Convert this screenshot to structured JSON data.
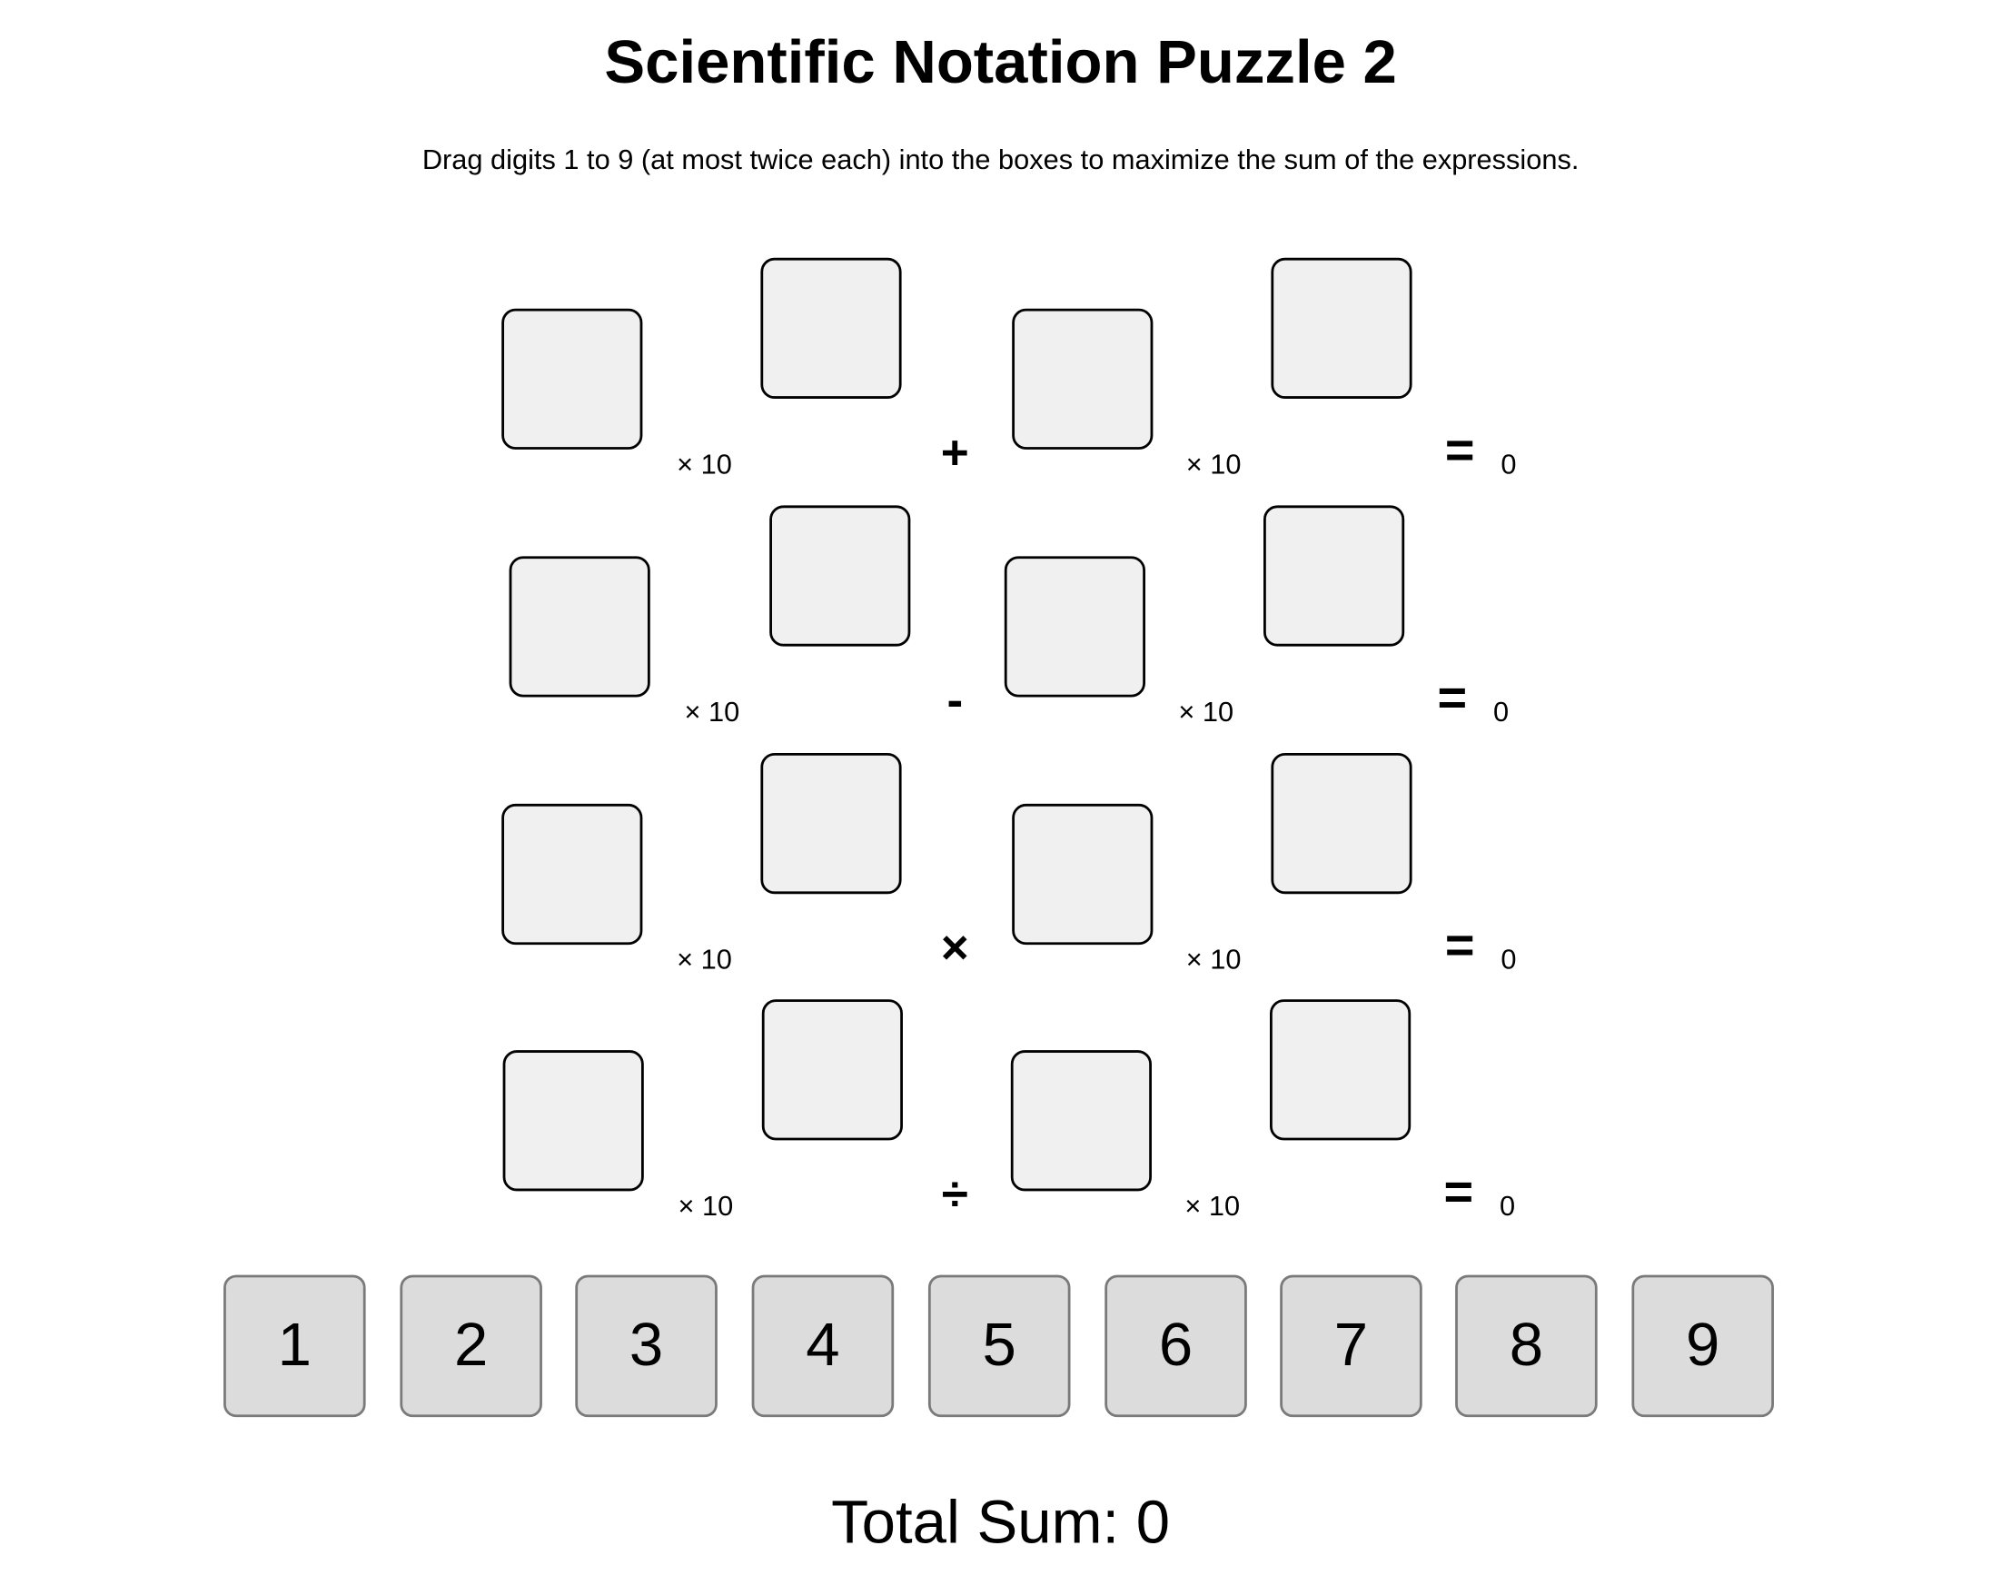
{
  "title": "Scientific Notation Puzzle 2",
  "instructions": "Drag digits 1 to 9 (at most twice each) into the boxes to maximize the sum of the expressions.",
  "expressions": [
    {
      "times_label": "× 10",
      "operator": "+",
      "equals": "=",
      "result": "0"
    },
    {
      "times_label": "× 10",
      "operator": "-",
      "equals": "=",
      "result": "0"
    },
    {
      "times_label": "× 10",
      "operator": "×",
      "equals": "=",
      "result": "0"
    },
    {
      "times_label": "× 10",
      "operator": "÷",
      "equals": "=",
      "result": "0"
    }
  ],
  "tiles": [
    "1",
    "2",
    "3",
    "4",
    "5",
    "6",
    "7",
    "8",
    "9"
  ],
  "total": {
    "label": "Total Sum: 0"
  }
}
